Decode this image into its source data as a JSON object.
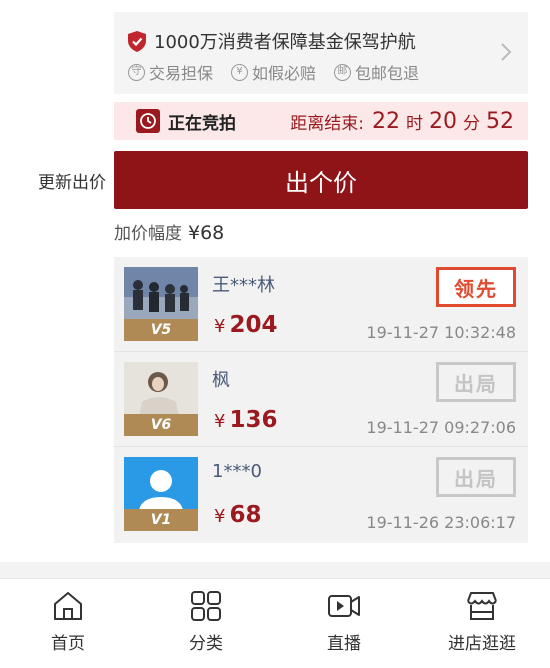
{
  "guarantee": {
    "title": "1000万消费者保障基金保驾护航",
    "items": [
      {
        "icon": "shield-check-icon",
        "glyph": "守",
        "label": "交易担保"
      },
      {
        "icon": "yen-circle-icon",
        "glyph": "¥",
        "label": "如假必赔"
      },
      {
        "icon": "mail-circle-icon",
        "glyph": "邮",
        "label": "包邮包退"
      }
    ]
  },
  "auction": {
    "status_label": "正在竞拍",
    "countdown_label": "距离结束:",
    "hours": "22",
    "hours_unit": "时",
    "minutes": "20",
    "minutes_unit": "分",
    "seconds": "52"
  },
  "bid_action": {
    "update_label": "更新出价",
    "button_label": "出个价"
  },
  "increment": {
    "label": "加价幅度",
    "value": "¥68"
  },
  "bids": [
    {
      "name": "王***林",
      "vip": "V5",
      "currency": "¥",
      "price": "204",
      "time": "19-11-27 10:32:48",
      "status": "领先"
    },
    {
      "name": "枫",
      "vip": "V6",
      "currency": "¥",
      "price": "136",
      "time": "19-11-27 09:27:06",
      "status": "出局"
    },
    {
      "name": "1***0",
      "vip": "V1",
      "currency": "¥",
      "price": "68",
      "time": "19-11-26 23:06:17",
      "status": "出局"
    }
  ],
  "tabbar": [
    {
      "label": "首页",
      "icon": "home-icon"
    },
    {
      "label": "分类",
      "icon": "grid-icon"
    },
    {
      "label": "直播",
      "icon": "live-video-icon"
    },
    {
      "label": "进店逛逛",
      "icon": "store-icon"
    }
  ],
  "colors": {
    "accent": "#8e1418",
    "lead": "#e04a2e",
    "status_bg": "#fce8e8"
  }
}
